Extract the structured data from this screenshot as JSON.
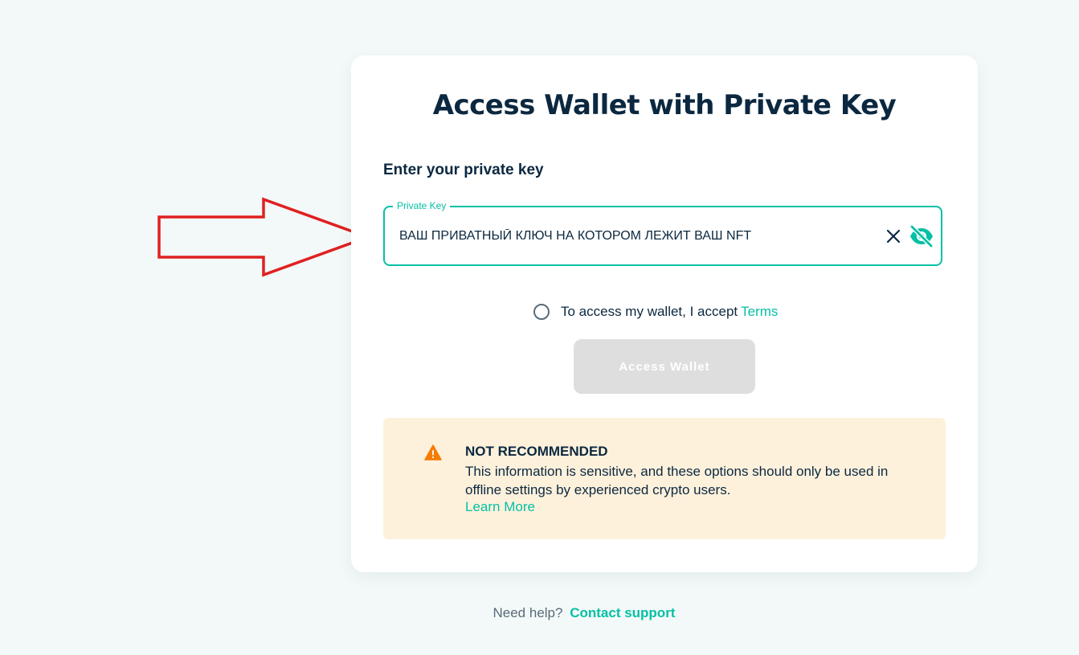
{
  "page": {
    "title": "Access Wallet with Private Key",
    "field_label": "Enter your private key",
    "private_key": {
      "legend": "Private Key",
      "value": "ВАШ ПРИВАТНЫЙ КЛЮЧ НА КОТОРОМ ЛЕЖИТ ВАШ NFT",
      "clear_icon": "close-icon",
      "visibility_icon": "eye-off-icon"
    },
    "terms": {
      "text": "To access my wallet, I accept",
      "link": "Terms"
    },
    "access_button": "Access Wallet",
    "warning": {
      "icon": "warning-icon",
      "title": "NOT RECOMMENDED",
      "text": "This information is sensitive, and these options should only be used in offline settings by experienced crypto users.",
      "link": "Learn More"
    },
    "help": {
      "text": "Need help?",
      "link": "Contact support"
    }
  },
  "colors": {
    "accent": "#05c0a5",
    "text": "#0b2840",
    "warning_bg": "#fef1dc",
    "warning_icon": "#f57c00",
    "annotation_arrow": "#e02020",
    "disabled_button": "#dedede"
  },
  "annotation": {
    "icon": "arrow-right-icon"
  }
}
